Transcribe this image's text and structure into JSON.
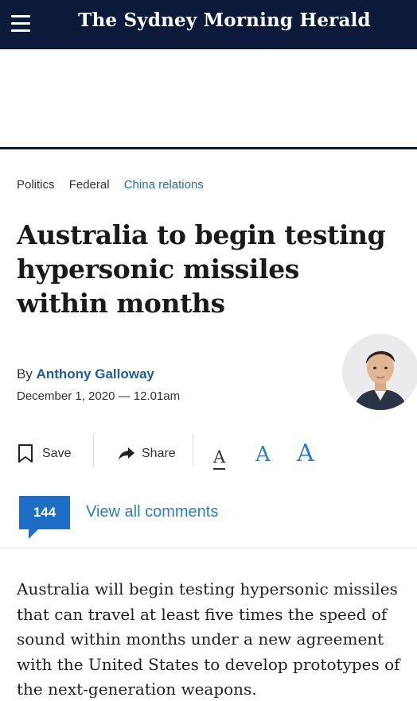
{
  "masthead": {
    "title": "The Sydney Morning Herald"
  },
  "breadcrumbs": [
    "Politics",
    "Federal",
    "China relations"
  ],
  "article": {
    "headline": "Australia to begin testing hypersonic missiles within months",
    "byline_prefix": "By",
    "author": "Anthony Galloway",
    "date": "December 1, 2020 — 12.01am",
    "body": "Australia will begin testing hypersonic missiles that can travel at least five times the speed of sound within months under a new agreement with the United States to develop prototypes of the next-generation weapons."
  },
  "actions": {
    "save_label": "Save",
    "share_label": "Share",
    "font_sizes": [
      "A",
      "A",
      "A"
    ]
  },
  "comments": {
    "count": "144",
    "link_text": "View all comments"
  },
  "colors": {
    "masthead_bg": "#0b1a3a",
    "accent": "#2b7fc4",
    "badge": "#1e6ec6"
  },
  "icons": {
    "menu": "hamburger-menu-icon",
    "save": "bookmark-icon",
    "share": "share-arrow-icon"
  }
}
